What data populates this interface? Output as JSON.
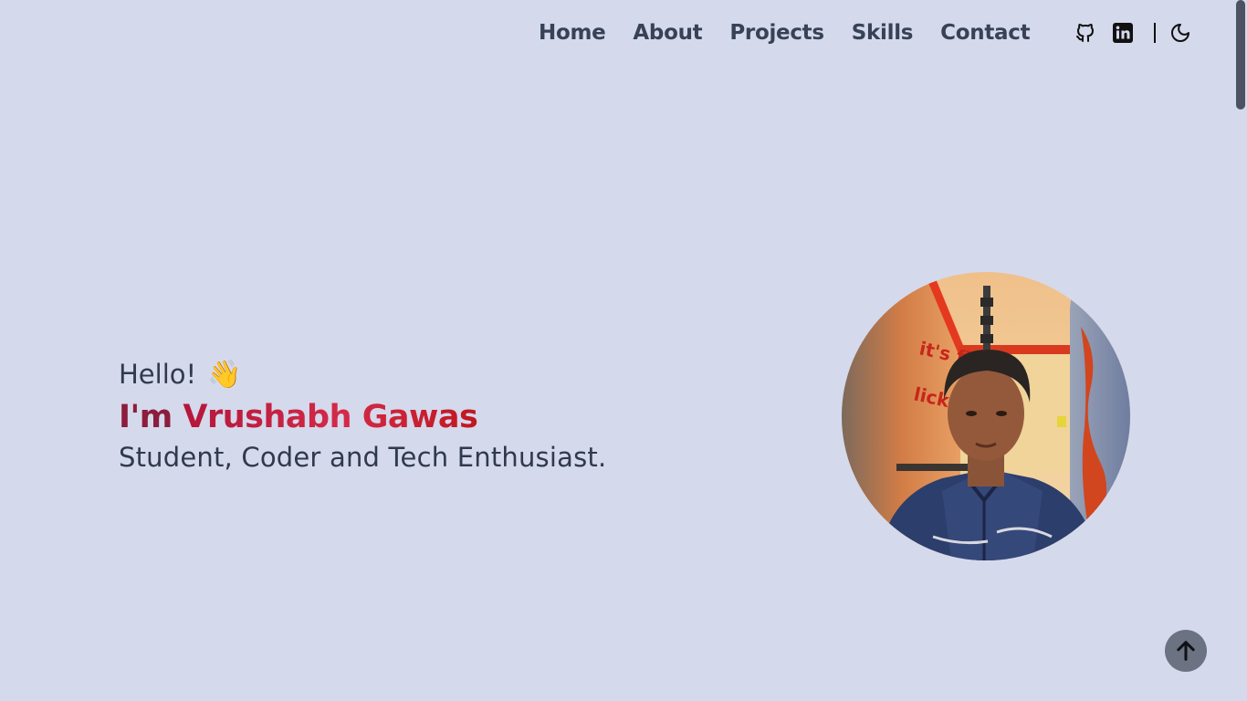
{
  "nav": {
    "items": [
      {
        "label": "Home"
      },
      {
        "label": "About"
      },
      {
        "label": "Projects"
      },
      {
        "label": "Skills"
      },
      {
        "label": "Contact"
      }
    ],
    "icons": [
      "github-icon",
      "linkedin-icon",
      "moon-icon"
    ]
  },
  "hero": {
    "greeting": "Hello!",
    "wave_emoji": "👋",
    "intro_prefix": "I'm",
    "name": "Vrushabh Gawas",
    "tagline": "Student, Coder and Tech Enthusiast."
  },
  "colors": {
    "background": "#d5d9ec",
    "text": "#374257",
    "accent": "#d42a48",
    "accent_dark": "#8c1d3c"
  },
  "back_to_top": {
    "icon": "arrow-up-icon"
  }
}
